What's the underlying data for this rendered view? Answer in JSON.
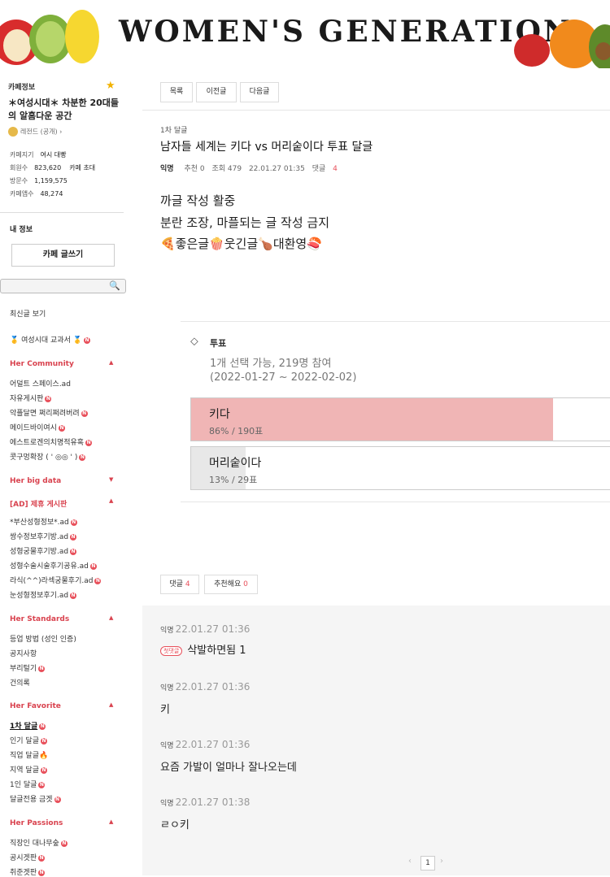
{
  "banner": {
    "title": "WOMEN'S GENERATION"
  },
  "sidebar": {
    "cafe_info_label": "카페정보",
    "cafe_title": "＊여성시대＊ 차분한 20대들의 알흠다운 공간",
    "rank": "레전드 (공개) ›",
    "stats": [
      {
        "label": "카페지기",
        "value": "여시 대빵"
      },
      {
        "label": "회원수",
        "value": "823,620",
        "extra": "카페 초대"
      },
      {
        "label": "방문수",
        "value": "1,159,575"
      },
      {
        "label": "카페앱수",
        "value": "48,274"
      }
    ],
    "my_info": "내 정보",
    "write_button": "카페 글쓰기",
    "search_placeholder": "",
    "recent": "최신글 보기",
    "textbook": "🥇 여성시대 교과서 🥇",
    "sections": [
      {
        "head": "Her Community",
        "items": [
          "어덜트 스페이스.ad",
          "자유게시판",
          "악플달면 쩌리쩌려버려",
          "메이드바이여시",
          "에스트로겐의치명적유혹",
          "콧구멍확장 ( ' ◎◎ ' )"
        ]
      },
      {
        "head": "Her big data",
        "items": []
      },
      {
        "head": "[AD] 제휴 게시판",
        "items": [
          "*부산성형정보*.ad",
          "쌍수정보후기방.ad",
          "성형궁물후기방.ad",
          "성형수술시술후기공유.ad",
          "라식(^^)라섹궁물후기.ad",
          "눈성형정보후기.ad"
        ]
      },
      {
        "head": "Her Standards",
        "items": [
          "등업 방법 (성인 인증)",
          "공지사항",
          "부리털기",
          "건의록"
        ]
      },
      {
        "head": "Her Favorite",
        "items": [
          "1차 달글",
          "인기 달글",
          "직업 달글🔥",
          "지역 달글",
          "1인 달글",
          "달글전용 금겟"
        ]
      },
      {
        "head": "Her Passions",
        "items": [
          "직장인 대나무숲",
          "공시겟판",
          "취준겟판"
        ]
      }
    ]
  },
  "post": {
    "buttons": [
      "목록",
      "이전글",
      "다음글"
    ],
    "board": "1차 달글",
    "title": "남자들 세계는 키다 vs 머리숱이다 투표 달글",
    "author": "익명",
    "recommend": "추천 0",
    "views": "조회 479",
    "date": "22.01.27 01:35",
    "comments_label": "댓글",
    "comments_count": "4",
    "body": [
      "까글 작성 활중",
      "분란 조장, 마플되는 글 작성 금지",
      "🍕좋은글🍿웃긴글🍗대환영🍣"
    ]
  },
  "vote": {
    "label": "투표",
    "info": "1개 선택 가능, 219명 참여",
    "period": "(2022-01-27 ~ 2022-02-02)",
    "options": [
      {
        "name": "키다",
        "result": "86% / 190표",
        "fraction": 0.86,
        "color": "#f0b5b5"
      },
      {
        "name": "머리숱이다",
        "result": "13% / 29표",
        "fraction": 0.13,
        "color": "#e8e8e8"
      }
    ]
  },
  "actions": {
    "comment_label": "댓글",
    "comment_count": "4",
    "recommend_label": "추천해요",
    "recommend_count": "0"
  },
  "comments": [
    {
      "who": "익명",
      "date": "22.01.27 01:36",
      "badge": "첫댓글",
      "text": "삭발하면됨 1"
    },
    {
      "who": "익명",
      "date": "22.01.27 01:36",
      "text": "키"
    },
    {
      "who": "익명",
      "date": "22.01.27 01:36",
      "text": "요즘 가발이 얼마나 잘나오는데"
    },
    {
      "who": "익명",
      "date": "22.01.27 01:38",
      "text": "ㄹㅇ키"
    }
  ],
  "pager": {
    "prev": "‹",
    "page": "1",
    "next": "›"
  }
}
